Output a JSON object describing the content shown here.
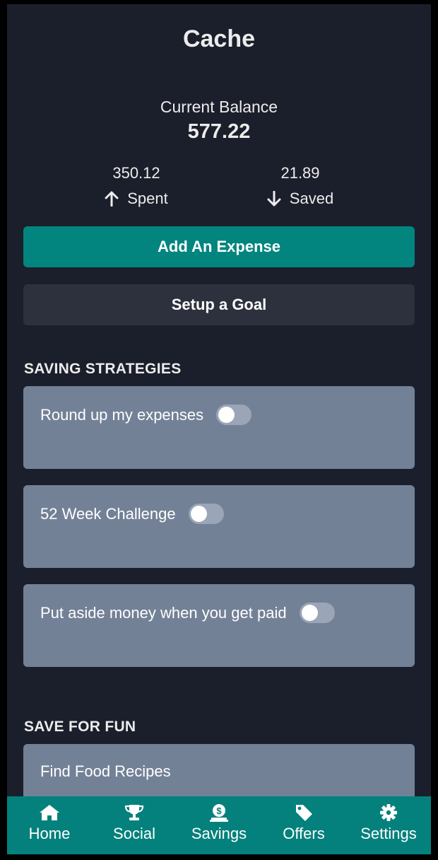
{
  "app": {
    "title": "Cache"
  },
  "balance": {
    "label": "Current Balance",
    "value": "577.22"
  },
  "stats": {
    "spent": {
      "value": "350.12",
      "label": "Spent"
    },
    "saved": {
      "value": "21.89",
      "label": "Saved"
    }
  },
  "actions": {
    "add_expense": "Add An Expense",
    "setup_goal": "Setup a Goal"
  },
  "saving_strategies": {
    "title": "SAVING STRATEGIES",
    "items": [
      {
        "label": "Round up my expenses",
        "enabled": false
      },
      {
        "label": "52 Week Challenge",
        "enabled": false
      },
      {
        "label": "Put aside money when you get paid",
        "enabled": false
      }
    ]
  },
  "save_for_fun": {
    "title": "SAVE FOR FUN",
    "items": [
      {
        "label": "Find Food Recipes"
      }
    ]
  },
  "tabbar": {
    "tabs": [
      {
        "label": "Home",
        "icon": "home-icon"
      },
      {
        "label": "Social",
        "icon": "trophy-icon"
      },
      {
        "label": "Savings",
        "icon": "savings-icon"
      },
      {
        "label": "Offers",
        "icon": "tag-icon"
      },
      {
        "label": "Settings",
        "icon": "gear-icon"
      }
    ]
  },
  "colors": {
    "background": "#1b1f2b",
    "accent": "#03857f",
    "card": "#738197",
    "secondary_button": "#2d313d"
  }
}
